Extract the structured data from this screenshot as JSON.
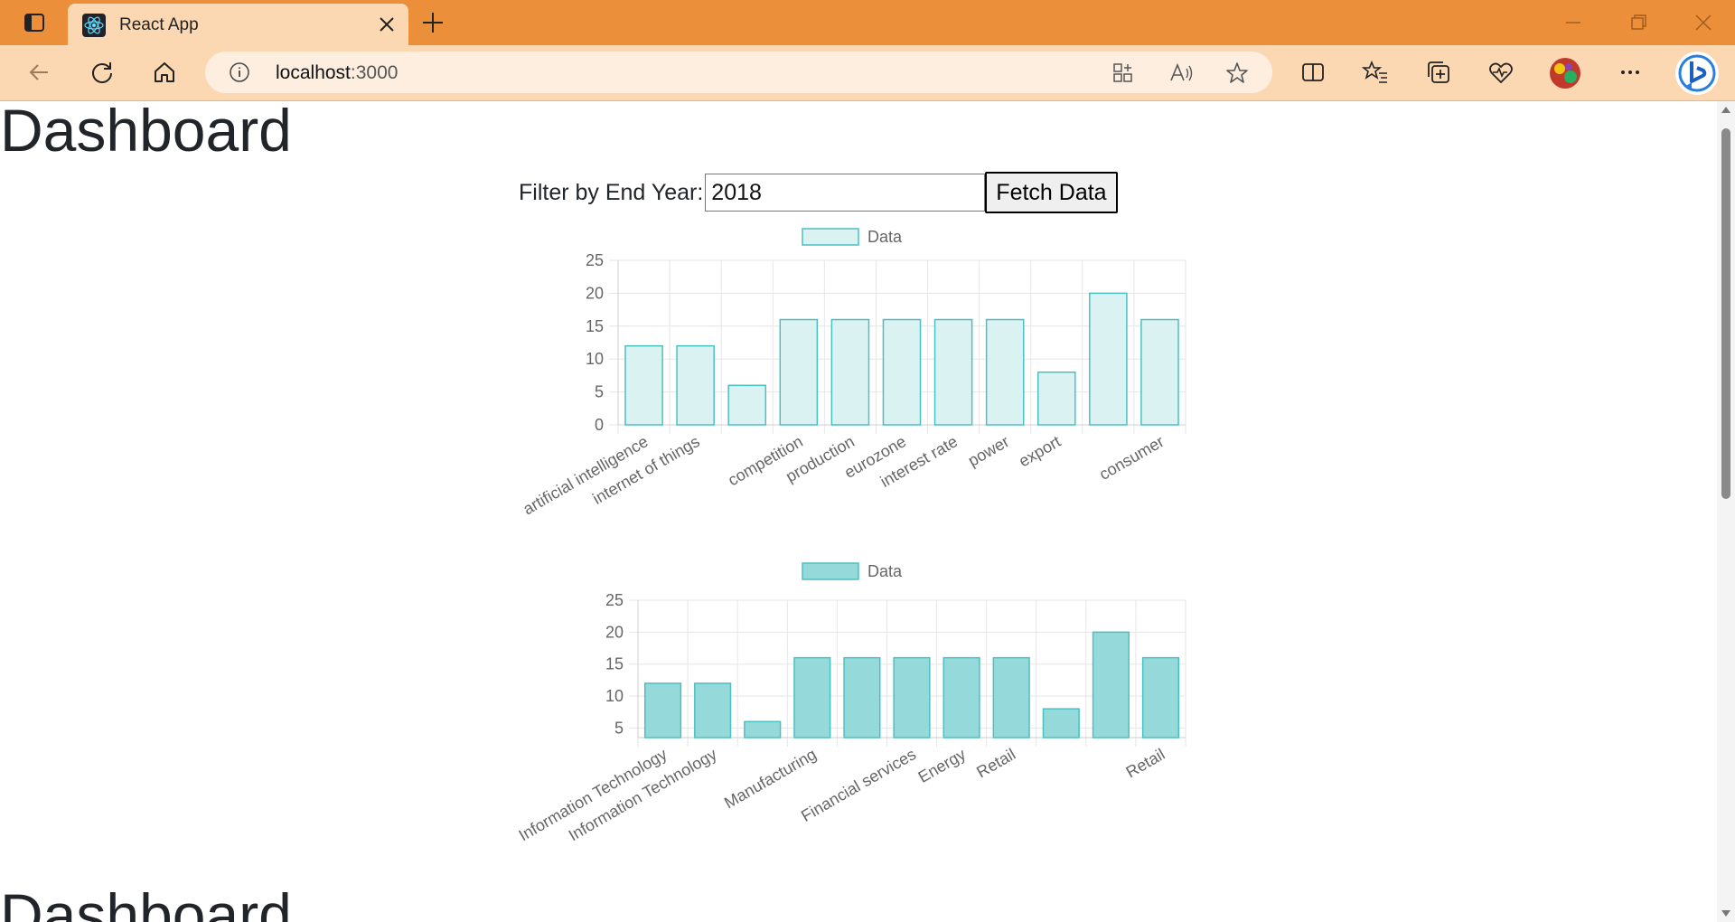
{
  "browser": {
    "tab_title": "React App",
    "url_host": "localhost",
    "url_port": ":3000"
  },
  "page": {
    "heading": "Dashboard",
    "filter_label": "Filter by End Year:",
    "filter_value": "2018",
    "fetch_button": "Fetch Data",
    "heading_repeat": "Dashboard"
  },
  "colors": {
    "browser_frame": "#ec8f3a",
    "toolbar": "#fbd8b2",
    "bar_fill_chart1": "#dbf2f2",
    "bar_fill_chart2": "#96d9da",
    "bar_stroke": "#4bc0c0"
  },
  "chart_data": [
    {
      "type": "bar",
      "legend": [
        "Data"
      ],
      "legend_position": "top",
      "grid": true,
      "ylim": [
        0,
        25
      ],
      "yticks": [
        0,
        5,
        10,
        15,
        20,
        25
      ],
      "categories": [
        "artificial intelligence",
        "internet of things",
        "",
        "competition",
        "production",
        "eurozone",
        "interest rate",
        "power",
        "export",
        "",
        "consumer"
      ],
      "series": [
        {
          "name": "Data",
          "values": [
            12,
            12,
            6,
            16,
            16,
            16,
            16,
            16,
            8,
            20,
            16
          ]
        }
      ]
    },
    {
      "type": "bar",
      "legend": [
        "Data"
      ],
      "legend_position": "top",
      "grid": true,
      "ylim": [
        3.5,
        25
      ],
      "yticks": [
        5,
        10,
        15,
        20,
        25
      ],
      "categories": [
        "Information Technology",
        "Information Technology",
        "",
        "Manufacturing",
        "",
        "Financial services",
        "Energy",
        "Retail",
        "",
        "",
        "Retail"
      ],
      "series": [
        {
          "name": "Data",
          "values": [
            12,
            12,
            6,
            16,
            16,
            16,
            16,
            16,
            8,
            20,
            16
          ]
        }
      ]
    }
  ]
}
